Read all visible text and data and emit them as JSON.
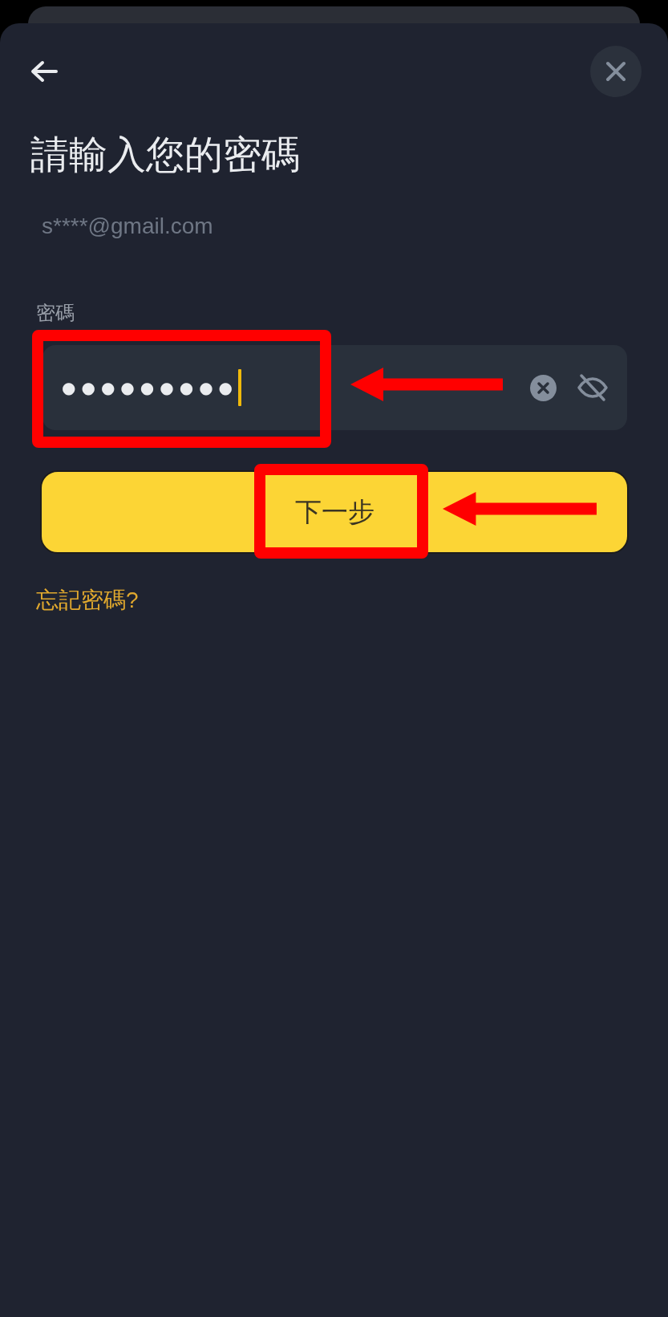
{
  "title": "請輸入您的密碼",
  "account": "s****@gmail.com",
  "password": {
    "label": "密碼",
    "value": "●●●●●●●●●",
    "focused": true,
    "highlighted": true,
    "pointer_arrow": true
  },
  "next_button": {
    "label": "下一步",
    "highlighted": true,
    "pointer_arrow": true
  },
  "forgot_link": "忘記密碼?"
}
